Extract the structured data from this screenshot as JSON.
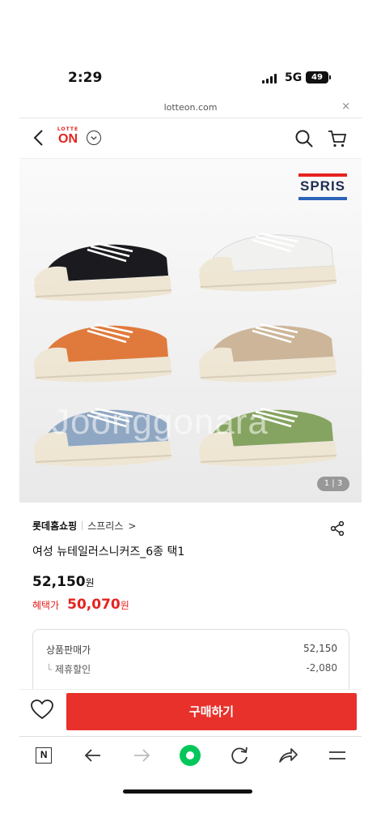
{
  "status_bar": {
    "time": "2:29",
    "network": "5G",
    "battery": "49"
  },
  "browser": {
    "url": "lotteon.com",
    "close": "×"
  },
  "header": {
    "logo_top": "LOTTE",
    "logo_main": "ON"
  },
  "gallery": {
    "brand": "SPRIS",
    "watermark": "Joonggonara",
    "counter": "1 | 3",
    "shoe_colors": [
      "#1b1b1f",
      "#f1f1ef",
      "#e07a3c",
      "#cdb599",
      "#8fa7c2",
      "#86a461"
    ]
  },
  "product": {
    "seller": "롯데홈쇼핑",
    "brand": "스프리스",
    "brand_arrow": ">",
    "title": "여성 뉴테일러스니커즈_6종 택1",
    "price_value": "52,150",
    "price_unit": "원",
    "benefit_label": "혜택가",
    "benefit_value": "50,070",
    "benefit_unit": "원"
  },
  "breakdown": {
    "rows": [
      {
        "label": "상품판매가",
        "value": "52,150"
      },
      {
        "label": "제휴할인",
        "value": "-2,080"
      }
    ]
  },
  "buy_bar": {
    "buy_label": "구매하기"
  },
  "toolbar": {
    "n_label": "N"
  },
  "colors": {
    "accent": "#e8312b",
    "brand_red": "#e5231f"
  }
}
